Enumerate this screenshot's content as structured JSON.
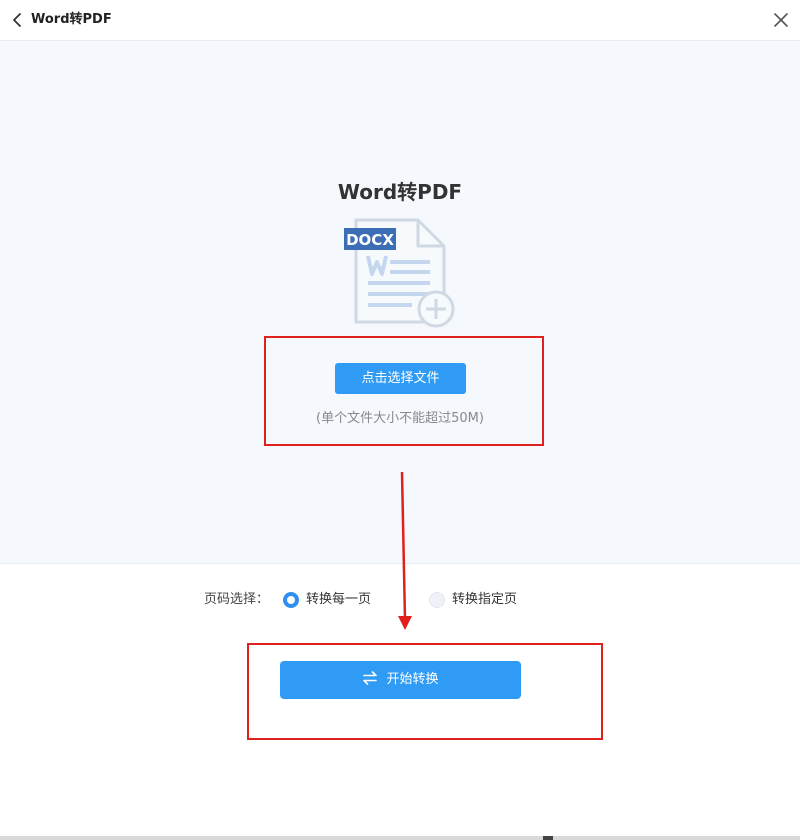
{
  "window": {
    "title": "Word转PDF"
  },
  "icons": {
    "back": "chevron-left-icon",
    "close": "close-icon",
    "document": "docx-document-add-icon",
    "swap": "swap-arrows-icon"
  },
  "upload": {
    "heading": "Word转PDF",
    "doc_badge": "DOCX",
    "select_button": "点击选择文件",
    "size_hint": "(单个文件大小不能超过50M)"
  },
  "options": {
    "page_label": "页码选择：",
    "choices": [
      {
        "label": "转换每一页",
        "selected": true
      },
      {
        "label": "转换指定页",
        "selected": false
      }
    ]
  },
  "actions": {
    "start_label": "开始转换"
  },
  "colors": {
    "accent": "#2f9bf4",
    "annotation": "#e0201c",
    "upload_bg": "#f5f9fe"
  }
}
